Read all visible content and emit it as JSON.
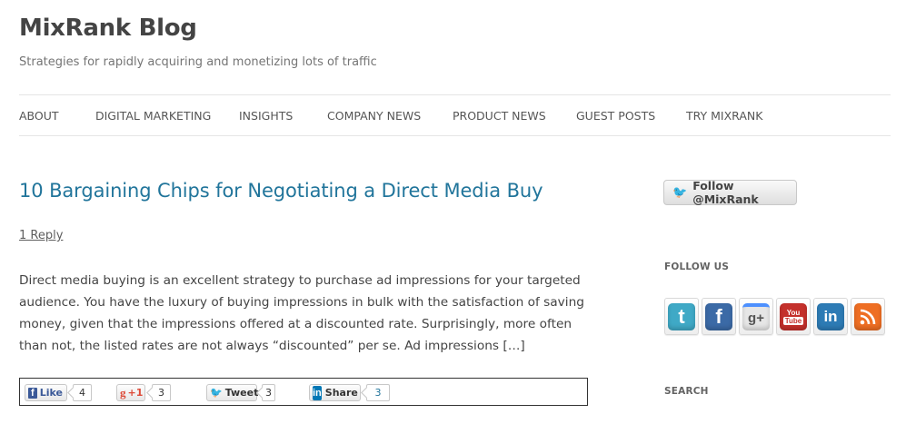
{
  "site": {
    "title": "MixRank Blog",
    "description": "Strategies for rapidly acquiring and monetizing lots of traffic"
  },
  "nav": {
    "items": [
      "ABOUT",
      "DIGITAL MARKETING",
      "INSIGHTS",
      "COMPANY NEWS",
      "PRODUCT NEWS",
      "GUEST POSTS",
      "TRY MIXRANK"
    ]
  },
  "post": {
    "title": "10 Bargaining Chips for Negotiating a Direct Media Buy",
    "reply_link": "1 Reply",
    "excerpt": "Direct media buying is an excellent strategy to purchase ad impressions for your targeted audience. You have the luxury of buying impressions in bulk with the satisfaction of saving money, given that the impressions offered at a discounted rate. Surprisingly, more often than not, the listed rates are not always “discounted” per se. Ad impressions […]"
  },
  "share": {
    "facebook": {
      "label": "Like",
      "count": "4",
      "icon": "facebook-icon"
    },
    "google": {
      "label": "+1",
      "count": "3",
      "icon": "google-plus-icon"
    },
    "twitter": {
      "label": "Tweet",
      "count": "3",
      "icon": "twitter-icon"
    },
    "linkedin": {
      "label": "Share",
      "count": "3",
      "icon": "linkedin-icon"
    }
  },
  "sidebar": {
    "follow_button": "Follow @MixRank",
    "follow_us_title": "FOLLOW US",
    "search_title": "SEARCH",
    "social_icons": [
      {
        "name": "twitter",
        "glyph": "t",
        "color": "#3fa9c6"
      },
      {
        "name": "facebook",
        "glyph": "f",
        "color": "#3b6aa6"
      },
      {
        "name": "google-plus",
        "glyph": "g+",
        "color": "#e8e8e8"
      },
      {
        "name": "youtube",
        "glyph": "You Tube",
        "color": "#c4302b"
      },
      {
        "name": "linkedin",
        "glyph": "in",
        "color": "#2d7bb5"
      },
      {
        "name": "rss",
        "glyph": "rss",
        "color": "#ee6e23"
      }
    ]
  },
  "colors": {
    "link": "#21759b",
    "text": "#444444",
    "border": "#e5e5e5"
  }
}
